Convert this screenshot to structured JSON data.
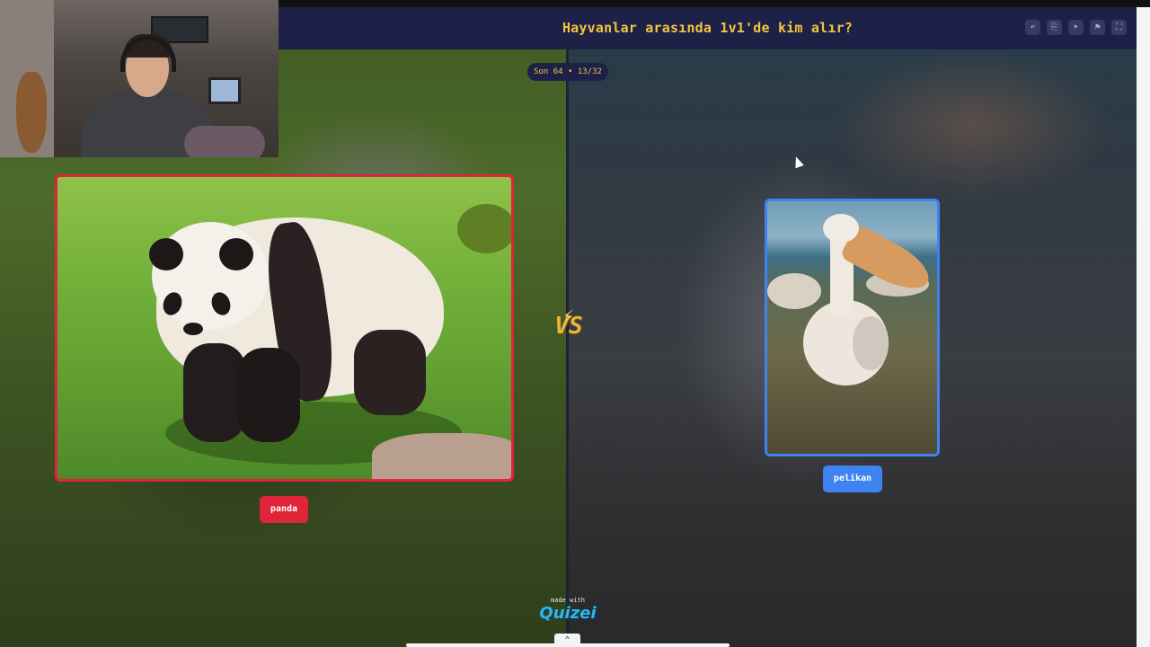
{
  "header": {
    "title": "Hayvanlar arasında 1v1'de kim alır?",
    "tools": [
      {
        "icon": "undo-icon",
        "glyph": "↶"
      },
      {
        "icon": "share-icon",
        "glyph": "⎘"
      },
      {
        "icon": "send-icon",
        "glyph": "➤"
      },
      {
        "icon": "flag-icon",
        "glyph": "⚑"
      },
      {
        "icon": "fullscreen-icon",
        "glyph": "⛶"
      }
    ]
  },
  "round": {
    "label": "Son 64 • 13/32"
  },
  "left_choice": {
    "label": "panda",
    "accent": "#e0243a"
  },
  "right_choice": {
    "label": "pelikan",
    "accent": "#3f83f0"
  },
  "vs": {
    "text": "VS",
    "icon": "lightning-bolt-icon",
    "glyph": "⚡"
  },
  "footer": {
    "made_with": "made with",
    "brand": "Quizei",
    "handle_glyph": "⌃"
  },
  "colors": {
    "header_bg": "#1e2147",
    "title": "#f2c53d"
  }
}
